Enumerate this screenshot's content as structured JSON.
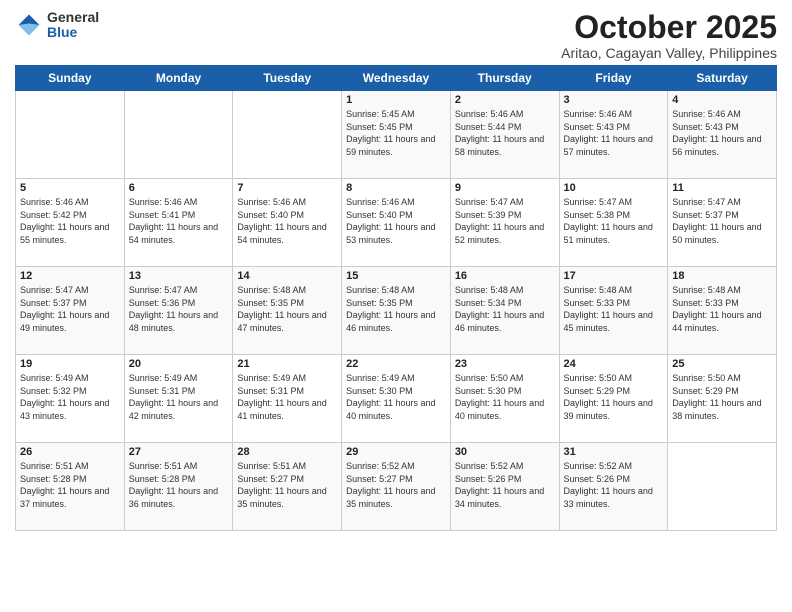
{
  "header": {
    "logo_general": "General",
    "logo_blue": "Blue",
    "month_title": "October 2025",
    "subtitle": "Aritao, Cagayan Valley, Philippines"
  },
  "weekdays": [
    "Sunday",
    "Monday",
    "Tuesday",
    "Wednesday",
    "Thursday",
    "Friday",
    "Saturday"
  ],
  "weeks": [
    [
      {
        "day": "",
        "sunrise": "",
        "sunset": "",
        "daylight": ""
      },
      {
        "day": "",
        "sunrise": "",
        "sunset": "",
        "daylight": ""
      },
      {
        "day": "",
        "sunrise": "",
        "sunset": "",
        "daylight": ""
      },
      {
        "day": "1",
        "sunrise": "Sunrise: 5:45 AM",
        "sunset": "Sunset: 5:45 PM",
        "daylight": "Daylight: 11 hours and 59 minutes."
      },
      {
        "day": "2",
        "sunrise": "Sunrise: 5:46 AM",
        "sunset": "Sunset: 5:44 PM",
        "daylight": "Daylight: 11 hours and 58 minutes."
      },
      {
        "day": "3",
        "sunrise": "Sunrise: 5:46 AM",
        "sunset": "Sunset: 5:43 PM",
        "daylight": "Daylight: 11 hours and 57 minutes."
      },
      {
        "day": "4",
        "sunrise": "Sunrise: 5:46 AM",
        "sunset": "Sunset: 5:43 PM",
        "daylight": "Daylight: 11 hours and 56 minutes."
      }
    ],
    [
      {
        "day": "5",
        "sunrise": "Sunrise: 5:46 AM",
        "sunset": "Sunset: 5:42 PM",
        "daylight": "Daylight: 11 hours and 55 minutes."
      },
      {
        "day": "6",
        "sunrise": "Sunrise: 5:46 AM",
        "sunset": "Sunset: 5:41 PM",
        "daylight": "Daylight: 11 hours and 54 minutes."
      },
      {
        "day": "7",
        "sunrise": "Sunrise: 5:46 AM",
        "sunset": "Sunset: 5:40 PM",
        "daylight": "Daylight: 11 hours and 54 minutes."
      },
      {
        "day": "8",
        "sunrise": "Sunrise: 5:46 AM",
        "sunset": "Sunset: 5:40 PM",
        "daylight": "Daylight: 11 hours and 53 minutes."
      },
      {
        "day": "9",
        "sunrise": "Sunrise: 5:47 AM",
        "sunset": "Sunset: 5:39 PM",
        "daylight": "Daylight: 11 hours and 52 minutes."
      },
      {
        "day": "10",
        "sunrise": "Sunrise: 5:47 AM",
        "sunset": "Sunset: 5:38 PM",
        "daylight": "Daylight: 11 hours and 51 minutes."
      },
      {
        "day": "11",
        "sunrise": "Sunrise: 5:47 AM",
        "sunset": "Sunset: 5:37 PM",
        "daylight": "Daylight: 11 hours and 50 minutes."
      }
    ],
    [
      {
        "day": "12",
        "sunrise": "Sunrise: 5:47 AM",
        "sunset": "Sunset: 5:37 PM",
        "daylight": "Daylight: 11 hours and 49 minutes."
      },
      {
        "day": "13",
        "sunrise": "Sunrise: 5:47 AM",
        "sunset": "Sunset: 5:36 PM",
        "daylight": "Daylight: 11 hours and 48 minutes."
      },
      {
        "day": "14",
        "sunrise": "Sunrise: 5:48 AM",
        "sunset": "Sunset: 5:35 PM",
        "daylight": "Daylight: 11 hours and 47 minutes."
      },
      {
        "day": "15",
        "sunrise": "Sunrise: 5:48 AM",
        "sunset": "Sunset: 5:35 PM",
        "daylight": "Daylight: 11 hours and 46 minutes."
      },
      {
        "day": "16",
        "sunrise": "Sunrise: 5:48 AM",
        "sunset": "Sunset: 5:34 PM",
        "daylight": "Daylight: 11 hours and 46 minutes."
      },
      {
        "day": "17",
        "sunrise": "Sunrise: 5:48 AM",
        "sunset": "Sunset: 5:33 PM",
        "daylight": "Daylight: 11 hours and 45 minutes."
      },
      {
        "day": "18",
        "sunrise": "Sunrise: 5:48 AM",
        "sunset": "Sunset: 5:33 PM",
        "daylight": "Daylight: 11 hours and 44 minutes."
      }
    ],
    [
      {
        "day": "19",
        "sunrise": "Sunrise: 5:49 AM",
        "sunset": "Sunset: 5:32 PM",
        "daylight": "Daylight: 11 hours and 43 minutes."
      },
      {
        "day": "20",
        "sunrise": "Sunrise: 5:49 AM",
        "sunset": "Sunset: 5:31 PM",
        "daylight": "Daylight: 11 hours and 42 minutes."
      },
      {
        "day": "21",
        "sunrise": "Sunrise: 5:49 AM",
        "sunset": "Sunset: 5:31 PM",
        "daylight": "Daylight: 11 hours and 41 minutes."
      },
      {
        "day": "22",
        "sunrise": "Sunrise: 5:49 AM",
        "sunset": "Sunset: 5:30 PM",
        "daylight": "Daylight: 11 hours and 40 minutes."
      },
      {
        "day": "23",
        "sunrise": "Sunrise: 5:50 AM",
        "sunset": "Sunset: 5:30 PM",
        "daylight": "Daylight: 11 hours and 40 minutes."
      },
      {
        "day": "24",
        "sunrise": "Sunrise: 5:50 AM",
        "sunset": "Sunset: 5:29 PM",
        "daylight": "Daylight: 11 hours and 39 minutes."
      },
      {
        "day": "25",
        "sunrise": "Sunrise: 5:50 AM",
        "sunset": "Sunset: 5:29 PM",
        "daylight": "Daylight: 11 hours and 38 minutes."
      }
    ],
    [
      {
        "day": "26",
        "sunrise": "Sunrise: 5:51 AM",
        "sunset": "Sunset: 5:28 PM",
        "daylight": "Daylight: 11 hours and 37 minutes."
      },
      {
        "day": "27",
        "sunrise": "Sunrise: 5:51 AM",
        "sunset": "Sunset: 5:28 PM",
        "daylight": "Daylight: 11 hours and 36 minutes."
      },
      {
        "day": "28",
        "sunrise": "Sunrise: 5:51 AM",
        "sunset": "Sunset: 5:27 PM",
        "daylight": "Daylight: 11 hours and 35 minutes."
      },
      {
        "day": "29",
        "sunrise": "Sunrise: 5:52 AM",
        "sunset": "Sunset: 5:27 PM",
        "daylight": "Daylight: 11 hours and 35 minutes."
      },
      {
        "day": "30",
        "sunrise": "Sunrise: 5:52 AM",
        "sunset": "Sunset: 5:26 PM",
        "daylight": "Daylight: 11 hours and 34 minutes."
      },
      {
        "day": "31",
        "sunrise": "Sunrise: 5:52 AM",
        "sunset": "Sunset: 5:26 PM",
        "daylight": "Daylight: 11 hours and 33 minutes."
      },
      {
        "day": "",
        "sunrise": "",
        "sunset": "",
        "daylight": ""
      }
    ]
  ]
}
